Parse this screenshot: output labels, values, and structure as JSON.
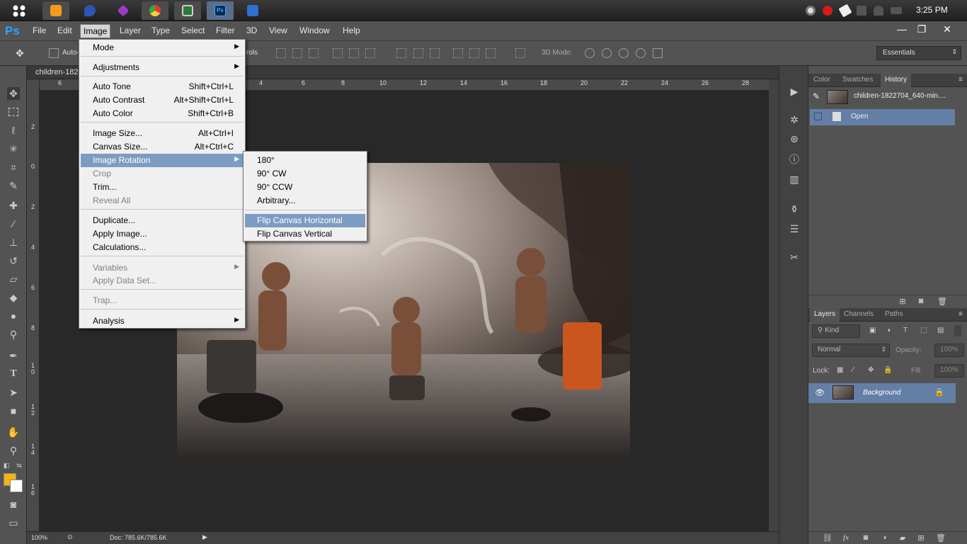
{
  "taskbar": {
    "clock": "3:25 PM"
  },
  "app": {
    "logo": "Ps"
  },
  "menubar": {
    "items": [
      "File",
      "Edit",
      "Image",
      "Layer",
      "Type",
      "Select",
      "Filter",
      "3D",
      "View",
      "Window",
      "Help"
    ],
    "active": "Image"
  },
  "window_controls": {
    "minimize": "—",
    "restore": "❐",
    "close": "✕"
  },
  "options_bar": {
    "auto_select_label": "Auto-",
    "controls_label": "rols",
    "mode_3d_label": "3D Mode:",
    "workspace": "Essentials"
  },
  "document": {
    "tab_title": "children-182",
    "zoom": "100%",
    "doc_info": "Doc: 785.6K/785.6K"
  },
  "rulers": {
    "horizontal": [
      "6",
      "4",
      "6",
      "8",
      "10",
      "12",
      "14",
      "16",
      "18",
      "20",
      "22",
      "24",
      "26",
      "28"
    ],
    "vertical": [
      "2",
      "0",
      "2",
      "4",
      "6",
      "8",
      "1\n0",
      "1\n2",
      "1\n4",
      "1\n6"
    ]
  },
  "image_menu": {
    "items": [
      {
        "label": "Mode",
        "shortcut": "",
        "submenu": true,
        "disabled": false
      },
      {
        "label": "Adjustments",
        "shortcut": "",
        "submenu": true,
        "disabled": false
      },
      {
        "label": "Auto Tone",
        "shortcut": "Shift+Ctrl+L",
        "submenu": false,
        "disabled": false
      },
      {
        "label": "Auto Contrast",
        "shortcut": "Alt+Shift+Ctrl+L",
        "submenu": false,
        "disabled": false
      },
      {
        "label": "Auto Color",
        "shortcut": "Shift+Ctrl+B",
        "submenu": false,
        "disabled": false
      },
      {
        "label": "Image Size...",
        "shortcut": "Alt+Ctrl+I",
        "submenu": false,
        "disabled": false
      },
      {
        "label": "Canvas Size...",
        "shortcut": "Alt+Ctrl+C",
        "submenu": false,
        "disabled": false
      },
      {
        "label": "Image Rotation",
        "shortcut": "",
        "submenu": true,
        "disabled": false,
        "highlighted": true
      },
      {
        "label": "Crop",
        "shortcut": "",
        "submenu": false,
        "disabled": true
      },
      {
        "label": "Trim...",
        "shortcut": "",
        "submenu": false,
        "disabled": false
      },
      {
        "label": "Reveal All",
        "shortcut": "",
        "submenu": false,
        "disabled": true
      },
      {
        "label": "Duplicate...",
        "shortcut": "",
        "submenu": false,
        "disabled": false
      },
      {
        "label": "Apply Image...",
        "shortcut": "",
        "submenu": false,
        "disabled": false
      },
      {
        "label": "Calculations...",
        "shortcut": "",
        "submenu": false,
        "disabled": false
      },
      {
        "label": "Variables",
        "shortcut": "",
        "submenu": true,
        "disabled": true
      },
      {
        "label": "Apply Data Set...",
        "shortcut": "",
        "submenu": false,
        "disabled": true
      },
      {
        "label": "Trap...",
        "shortcut": "",
        "submenu": false,
        "disabled": true
      },
      {
        "label": "Analysis",
        "shortcut": "",
        "submenu": true,
        "disabled": false
      }
    ]
  },
  "rotation_submenu": {
    "items": [
      {
        "label": "180°"
      },
      {
        "label": "90° CW"
      },
      {
        "label": "90° CCW"
      },
      {
        "label": "Arbitrary..."
      },
      {
        "label": "Flip Canvas Horizontal",
        "highlighted": true
      },
      {
        "label": "Flip Canvas Vertical"
      }
    ]
  },
  "history_panel": {
    "tabs": [
      "Color",
      "Swatches",
      "History"
    ],
    "active_tab": "History",
    "snapshot": "children-1822704_640-min....",
    "steps": [
      "Open"
    ]
  },
  "layers_panel": {
    "tabs": [
      "Layers",
      "Channels",
      "Paths"
    ],
    "active_tab": "Layers",
    "filter_label": "Kind",
    "blend_mode": "Normal",
    "opacity_label": "Opacity:",
    "opacity_value": "100%",
    "lock_label": "Lock:",
    "fill_label": "Fill:",
    "fill_value": "100%",
    "layers": [
      {
        "name": "Background",
        "visible": true,
        "locked": true
      }
    ]
  },
  "colors": {
    "foreground": "#f5b40e",
    "background": "#ffffff",
    "ps_blue": "#2fa3ff",
    "selection": "#647fa6"
  }
}
